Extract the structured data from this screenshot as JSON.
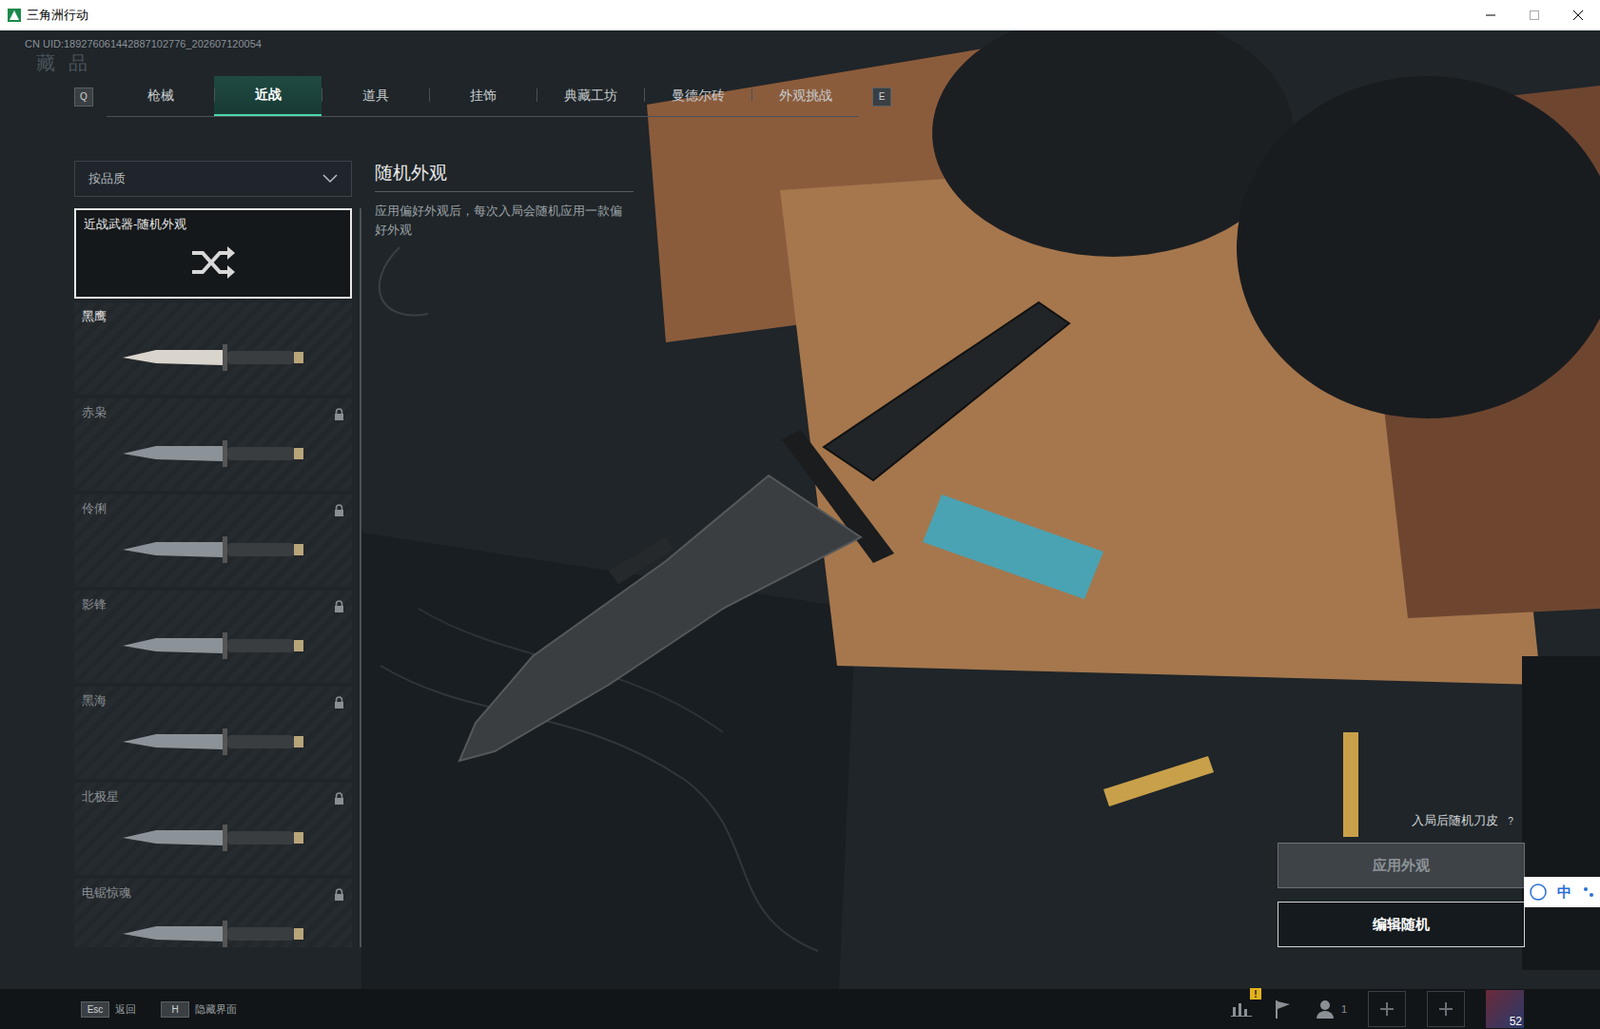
{
  "window": {
    "title": "三角洲行动"
  },
  "uid": "CN UID:189276061442887102776_202607120054",
  "page_title": "藏品",
  "tabs": {
    "prev_key": "Q",
    "next_key": "E",
    "items": [
      {
        "label": "枪械",
        "selected": false
      },
      {
        "label": "近战",
        "selected": true
      },
      {
        "label": "道具",
        "selected": false
      },
      {
        "label": "挂饰",
        "selected": false
      },
      {
        "label": "典藏工坊",
        "selected": false
      },
      {
        "label": "曼德尔砖",
        "selected": false
      },
      {
        "label": "外观挑战",
        "selected": false
      }
    ]
  },
  "filter": {
    "label": "按品质"
  },
  "items": [
    {
      "name": "近战武器-随机外观",
      "kind": "random",
      "selected": true,
      "locked": false
    },
    {
      "name": "黑鹰",
      "kind": "skin",
      "selected": false,
      "locked": false
    },
    {
      "name": "赤枭",
      "kind": "skin",
      "selected": false,
      "locked": true
    },
    {
      "name": "伶俐",
      "kind": "skin",
      "selected": false,
      "locked": true
    },
    {
      "name": "影锋",
      "kind": "skin",
      "selected": false,
      "locked": true
    },
    {
      "name": "黑海",
      "kind": "skin",
      "selected": false,
      "locked": true
    },
    {
      "name": "北极星",
      "kind": "skin",
      "selected": false,
      "locked": true
    },
    {
      "name": "电锯惊魂",
      "kind": "skin",
      "selected": false,
      "locked": true
    }
  ],
  "detail": {
    "title": "随机外观",
    "description": "应用偏好外观后，每次入局会随机应用一款偏好外观"
  },
  "random_hint": {
    "label": "入局后随机刀皮",
    "help": "?"
  },
  "buttons": [
    {
      "label": "应用外观",
      "disabled": true
    },
    {
      "label": "编辑随机",
      "disabled": false
    }
  ],
  "ime": {
    "label": "中"
  },
  "footer": {
    "keys": [
      {
        "key": "Esc",
        "label": "返回"
      },
      {
        "key": "H",
        "label": "隐藏界面"
      }
    ],
    "alert_badge": "!",
    "squad_count": "1",
    "level": "52"
  }
}
